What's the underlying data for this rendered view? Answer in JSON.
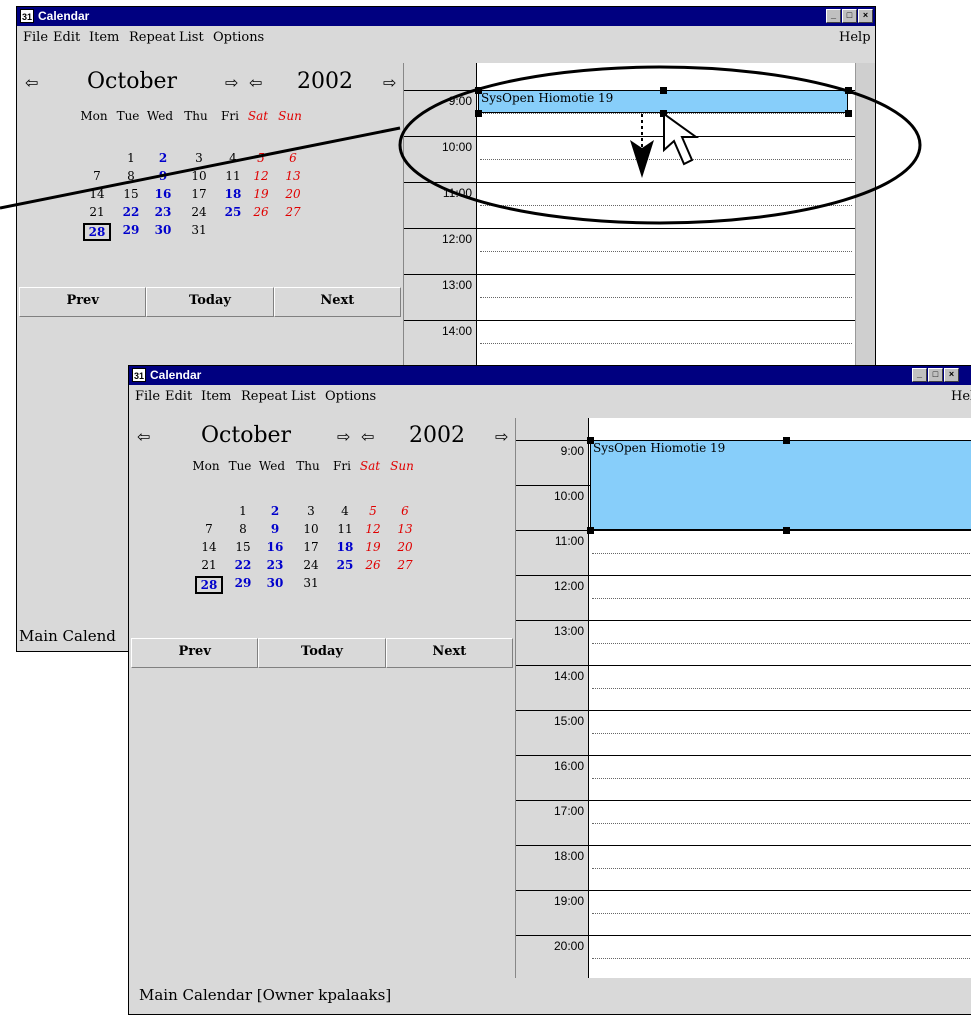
{
  "window_title": "Calendar",
  "menu": {
    "file": "File",
    "edit": "Edit",
    "item": "Item",
    "repeat": "Repeat",
    "list": "List",
    "options": "Options",
    "help": "Help"
  },
  "month": "October",
  "year": "2002",
  "weekdays": [
    "Mon",
    "Tue",
    "Wed",
    "Thu",
    "Fri",
    "Sat",
    "Sun"
  ],
  "weeks": [
    [
      "",
      "",
      "",
      "",
      "",
      "",
      ""
    ],
    [
      "",
      "1",
      "2",
      "3",
      "4",
      "5",
      "6"
    ],
    [
      "7",
      "8",
      "9",
      "10",
      "11",
      "12",
      "13"
    ],
    [
      "14",
      "15",
      "16",
      "17",
      "18",
      "19",
      "20"
    ],
    [
      "21",
      "22",
      "23",
      "24",
      "25",
      "26",
      "27"
    ],
    [
      "28",
      "29",
      "30",
      "31",
      "",
      "",
      ""
    ]
  ],
  "nav": {
    "prev": "Prev",
    "today": "Today",
    "next": "Next"
  },
  "event_title": "SysOpen Hiomotie 19",
  "back_hours": [
    "9:00",
    "10:00",
    "11:00",
    "12:00",
    "13:00",
    "14:00"
  ],
  "front_hours": [
    "9:00",
    "10:00",
    "11:00",
    "12:00",
    "13:00",
    "14:00",
    "15:00",
    "16:00",
    "17:00",
    "18:00",
    "19:00",
    "20:00"
  ],
  "status_back": "Main Calend",
  "status_front": "Main Calendar [Owner kpalaaks]",
  "colors": {
    "event": "#87cefa",
    "titlebar": "#000080",
    "bold_day": "#0000cc",
    "weekend": "#e00000",
    "window": "#d9d9d9"
  }
}
